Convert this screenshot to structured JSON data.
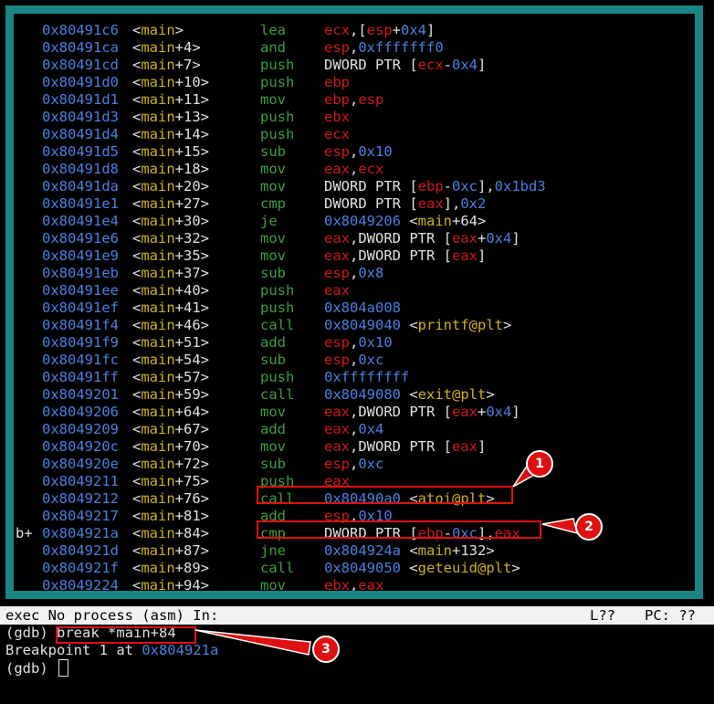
{
  "asm_rows": [
    {
      "mark": "",
      "addr": "0x80491c6",
      "sym": "<main>",
      "mn": "lea",
      "ops": [
        [
          "ecx",
          "reg"
        ],
        [
          ",[",
          "plain"
        ],
        [
          "esp",
          "reg"
        ],
        [
          "+",
          "plain"
        ],
        [
          "0x4",
          "num"
        ],
        [
          "]",
          "plain"
        ]
      ]
    },
    {
      "mark": "",
      "addr": "0x80491ca",
      "sym": "<main+4>",
      "mn": "and",
      "ops": [
        [
          "esp",
          "reg"
        ],
        [
          ",",
          "plain"
        ],
        [
          "0xfffffff0",
          "num"
        ]
      ]
    },
    {
      "mark": "",
      "addr": "0x80491cd",
      "sym": "<main+7>",
      "mn": "push",
      "ops": [
        [
          "DWORD PTR [",
          "plain"
        ],
        [
          "ecx",
          "reg"
        ],
        [
          "-",
          "plain"
        ],
        [
          "0x4",
          "num"
        ],
        [
          "]",
          "plain"
        ]
      ]
    },
    {
      "mark": "",
      "addr": "0x80491d0",
      "sym": "<main+10>",
      "mn": "push",
      "ops": [
        [
          "ebp",
          "reg"
        ]
      ]
    },
    {
      "mark": "",
      "addr": "0x80491d1",
      "sym": "<main+11>",
      "mn": "mov",
      "ops": [
        [
          "ebp",
          "reg"
        ],
        [
          ",",
          "plain"
        ],
        [
          "esp",
          "reg"
        ]
      ]
    },
    {
      "mark": "",
      "addr": "0x80491d3",
      "sym": "<main+13>",
      "mn": "push",
      "ops": [
        [
          "ebx",
          "reg"
        ]
      ]
    },
    {
      "mark": "",
      "addr": "0x80491d4",
      "sym": "<main+14>",
      "mn": "push",
      "ops": [
        [
          "ecx",
          "reg"
        ]
      ]
    },
    {
      "mark": "",
      "addr": "0x80491d5",
      "sym": "<main+15>",
      "mn": "sub",
      "ops": [
        [
          "esp",
          "reg"
        ],
        [
          ",",
          "plain"
        ],
        [
          "0x10",
          "num"
        ]
      ]
    },
    {
      "mark": "",
      "addr": "0x80491d8",
      "sym": "<main+18>",
      "mn": "mov",
      "ops": [
        [
          "eax",
          "reg"
        ],
        [
          ",",
          "plain"
        ],
        [
          "ecx",
          "reg"
        ]
      ]
    },
    {
      "mark": "",
      "addr": "0x80491da",
      "sym": "<main+20>",
      "mn": "mov",
      "ops": [
        [
          "DWORD PTR [",
          "plain"
        ],
        [
          "ebp",
          "reg"
        ],
        [
          "-",
          "plain"
        ],
        [
          "0xc",
          "num"
        ],
        [
          "],",
          "plain"
        ],
        [
          "0x1bd3",
          "num"
        ]
      ]
    },
    {
      "mark": "",
      "addr": "0x80491e1",
      "sym": "<main+27>",
      "mn": "cmp",
      "ops": [
        [
          "DWORD PTR [",
          "plain"
        ],
        [
          "eax",
          "reg"
        ],
        [
          "],",
          "plain"
        ],
        [
          "0x2",
          "num"
        ]
      ]
    },
    {
      "mark": "",
      "addr": "0x80491e4",
      "sym": "<main+30>",
      "mn": "je",
      "ops": [
        [
          "0x8049206",
          "num"
        ],
        [
          " <",
          "plain"
        ],
        [
          "main",
          "name"
        ],
        [
          "+64>",
          "plain"
        ]
      ]
    },
    {
      "mark": "",
      "addr": "0x80491e6",
      "sym": "<main+32>",
      "mn": "mov",
      "ops": [
        [
          "eax",
          "reg"
        ],
        [
          ",DWORD PTR [",
          "plain"
        ],
        [
          "eax",
          "reg"
        ],
        [
          "+",
          "plain"
        ],
        [
          "0x4",
          "num"
        ],
        [
          "]",
          "plain"
        ]
      ]
    },
    {
      "mark": "",
      "addr": "0x80491e9",
      "sym": "<main+35>",
      "mn": "mov",
      "ops": [
        [
          "eax",
          "reg"
        ],
        [
          ",DWORD PTR [",
          "plain"
        ],
        [
          "eax",
          "reg"
        ],
        [
          "]",
          "plain"
        ]
      ]
    },
    {
      "mark": "",
      "addr": "0x80491eb",
      "sym": "<main+37>",
      "mn": "sub",
      "ops": [
        [
          "esp",
          "reg"
        ],
        [
          ",",
          "plain"
        ],
        [
          "0x8",
          "num"
        ]
      ]
    },
    {
      "mark": "",
      "addr": "0x80491ee",
      "sym": "<main+40>",
      "mn": "push",
      "ops": [
        [
          "eax",
          "reg"
        ]
      ]
    },
    {
      "mark": "",
      "addr": "0x80491ef",
      "sym": "<main+41>",
      "mn": "push",
      "ops": [
        [
          "0x804a008",
          "num"
        ]
      ]
    },
    {
      "mark": "",
      "addr": "0x80491f4",
      "sym": "<main+46>",
      "mn": "call",
      "ops": [
        [
          "0x8049040",
          "num"
        ],
        [
          " <",
          "plain"
        ],
        [
          "printf@plt",
          "name"
        ],
        [
          ">",
          "plain"
        ]
      ]
    },
    {
      "mark": "",
      "addr": "0x80491f9",
      "sym": "<main+51>",
      "mn": "add",
      "ops": [
        [
          "esp",
          "reg"
        ],
        [
          ",",
          "plain"
        ],
        [
          "0x10",
          "num"
        ]
      ]
    },
    {
      "mark": "",
      "addr": "0x80491fc",
      "sym": "<main+54>",
      "mn": "sub",
      "ops": [
        [
          "esp",
          "reg"
        ],
        [
          ",",
          "plain"
        ],
        [
          "0xc",
          "num"
        ]
      ]
    },
    {
      "mark": "",
      "addr": "0x80491ff",
      "sym": "<main+57>",
      "mn": "push",
      "ops": [
        [
          "0xffffffff",
          "num"
        ]
      ]
    },
    {
      "mark": "",
      "addr": "0x8049201",
      "sym": "<main+59>",
      "mn": "call",
      "ops": [
        [
          "0x8049080",
          "num"
        ],
        [
          " <",
          "plain"
        ],
        [
          "exit@plt",
          "name"
        ],
        [
          ">",
          "plain"
        ]
      ]
    },
    {
      "mark": "",
      "addr": "0x8049206",
      "sym": "<main+64>",
      "mn": "mov",
      "ops": [
        [
          "eax",
          "reg"
        ],
        [
          ",DWORD PTR [",
          "plain"
        ],
        [
          "eax",
          "reg"
        ],
        [
          "+",
          "plain"
        ],
        [
          "0x4",
          "num"
        ],
        [
          "]",
          "plain"
        ]
      ]
    },
    {
      "mark": "",
      "addr": "0x8049209",
      "sym": "<main+67>",
      "mn": "add",
      "ops": [
        [
          "eax",
          "reg"
        ],
        [
          ",",
          "plain"
        ],
        [
          "0x4",
          "num"
        ]
      ]
    },
    {
      "mark": "",
      "addr": "0x804920c",
      "sym": "<main+70>",
      "mn": "mov",
      "ops": [
        [
          "eax",
          "reg"
        ],
        [
          ",DWORD PTR [",
          "plain"
        ],
        [
          "eax",
          "reg"
        ],
        [
          "]",
          "plain"
        ]
      ]
    },
    {
      "mark": "",
      "addr": "0x804920e",
      "sym": "<main+72>",
      "mn": "sub",
      "ops": [
        [
          "esp",
          "reg"
        ],
        [
          ",",
          "plain"
        ],
        [
          "0xc",
          "num"
        ]
      ]
    },
    {
      "mark": "",
      "addr": "0x8049211",
      "sym": "<main+75>",
      "mn": "push",
      "ops": [
        [
          "eax",
          "reg"
        ]
      ]
    },
    {
      "mark": "",
      "addr": "0x8049212",
      "sym": "<main+76>",
      "mn": "call",
      "ops": [
        [
          "0x80490a0",
          "num"
        ],
        [
          " <",
          "plain"
        ],
        [
          "atoi@plt",
          "name"
        ],
        [
          ">",
          "plain"
        ]
      ]
    },
    {
      "mark": "",
      "addr": "0x8049217",
      "sym": "<main+81>",
      "mn": "add",
      "ops": [
        [
          "esp",
          "reg"
        ],
        [
          ",",
          "plain"
        ],
        [
          "0x10",
          "num"
        ]
      ]
    },
    {
      "mark": "b+",
      "addr": "0x804921a",
      "sym": "<main+84>",
      "mn": "cmp",
      "ops": [
        [
          "DWORD PTR [",
          "plain"
        ],
        [
          "ebp",
          "reg"
        ],
        [
          "-",
          "plain"
        ],
        [
          "0xc",
          "num"
        ],
        [
          "],",
          "plain"
        ],
        [
          "eax",
          "reg"
        ]
      ]
    },
    {
      "mark": "",
      "addr": "0x804921d",
      "sym": "<main+87>",
      "mn": "jne",
      "ops": [
        [
          "0x804924a",
          "num"
        ],
        [
          " <",
          "plain"
        ],
        [
          "main",
          "name"
        ],
        [
          "+132>",
          "plain"
        ]
      ]
    },
    {
      "mark": "",
      "addr": "0x804921f",
      "sym": "<main+89>",
      "mn": "call",
      "ops": [
        [
          "0x8049050",
          "num"
        ],
        [
          " <",
          "plain"
        ],
        [
          "geteuid@plt",
          "name"
        ],
        [
          ">",
          "plain"
        ]
      ]
    },
    {
      "mark": "",
      "addr": "0x8049224",
      "sym": "<main+94>",
      "mn": "mov",
      "ops": [
        [
          "ebx",
          "reg"
        ],
        [
          ",",
          "plain"
        ],
        [
          "eax",
          "reg"
        ]
      ]
    }
  ],
  "status_bar": {
    "left": "exec No process (asm) In:",
    "line": "L??",
    "pc": "PC: ??"
  },
  "console": {
    "prompt": "(gdb) ",
    "command": "break *main+84",
    "bp_text": "Breakpoint 1 at ",
    "bp_addr": "0x804921a",
    "prompt2": "(gdb) "
  },
  "annotations": {
    "badge1": "1",
    "badge2": "2",
    "badge3": "3"
  },
  "colors": {
    "frame": "#188484",
    "register": "#d01818",
    "number": "#4a80e0",
    "symbol": "#d0b020",
    "mnemonic": "#3e9e3e",
    "annotation": "#e01010"
  }
}
